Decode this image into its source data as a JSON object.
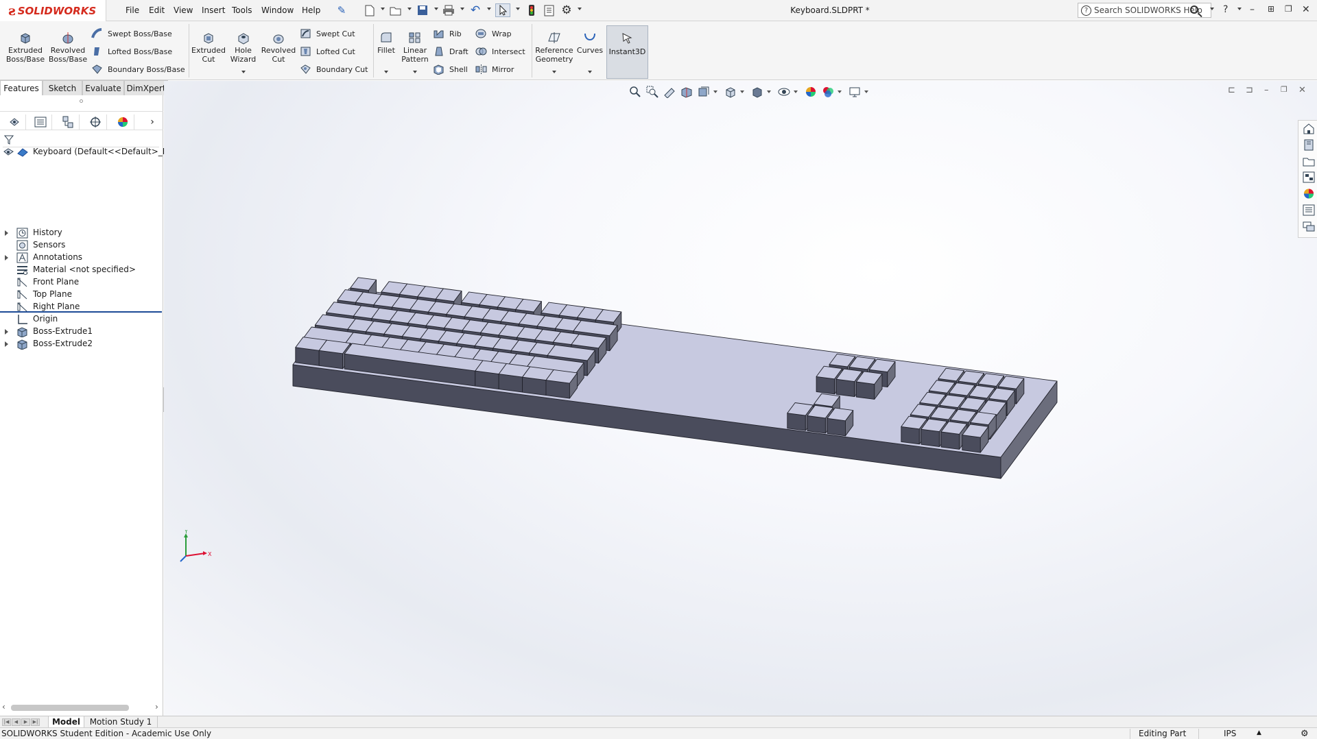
{
  "app": {
    "brand": "SOLIDWORKS",
    "document_title": "Keyboard.SLDPRT *"
  },
  "menu": [
    "File",
    "Edit",
    "View",
    "Insert",
    "Tools",
    "Window",
    "Help"
  ],
  "search": {
    "placeholder": "Search SOLIDWORKS Help"
  },
  "ribbon": {
    "extruded_boss": "Extruded Boss/Base",
    "revolved_boss": "Revolved Boss/Base",
    "swept_boss": "Swept Boss/Base",
    "lofted_boss": "Lofted Boss/Base",
    "boundary_boss": "Boundary Boss/Base",
    "extruded_cut": "Extruded Cut",
    "hole_wizard": "Hole Wizard",
    "revolved_cut": "Revolved Cut",
    "swept_cut": "Swept Cut",
    "lofted_cut": "Lofted Cut",
    "boundary_cut": "Boundary Cut",
    "fillet": "Fillet",
    "linear_pattern": "Linear Pattern",
    "rib": "Rib",
    "draft": "Draft",
    "shell": "Shell",
    "wrap": "Wrap",
    "intersect": "Intersect",
    "mirror": "Mirror",
    "reference_geometry": "Reference Geometry",
    "curves": "Curves",
    "instant3d": "Instant3D"
  },
  "command_tabs": [
    "Features",
    "Sketch",
    "Evaluate",
    "DimXpert"
  ],
  "tree": {
    "root": "Keyboard  (Default<<Default>_Disp",
    "items": [
      "History",
      "Sensors",
      "Annotations",
      "Material <not specified>",
      "Front Plane",
      "Top Plane",
      "Right Plane",
      "Origin",
      "Boss-Extrude1",
      "Boss-Extrude2"
    ]
  },
  "bottom_tabs": [
    "Model",
    "Motion Study 1"
  ],
  "status": {
    "edition": "SOLIDWORKS Student Edition - Academic Use Only",
    "mode": "Editing Part",
    "units": "IPS"
  },
  "colors": {
    "accent": "#1c4a96",
    "brand": "#d52b1e",
    "part_top": "#c7c9e0",
    "part_side": "#4a4c5c"
  }
}
